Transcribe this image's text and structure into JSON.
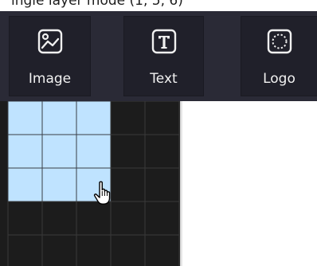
{
  "top_strip": {
    "text": "ingle layer mode (1, 5, 6)"
  },
  "toolbar": {
    "buttons": [
      {
        "label": "Image",
        "icon": "image-icon"
      },
      {
        "label": "Text",
        "icon": "text-icon"
      },
      {
        "label": "Logo",
        "icon": "logo-icon"
      }
    ]
  },
  "grid_selector": {
    "columns": 5,
    "rows": 5,
    "selected_columns": 3,
    "selected_rows": 3,
    "colors": {
      "selected_fill": "#bfe3ff",
      "selected_line": "#3a3f45",
      "empty_fill": "#1c1c1c",
      "empty_line": "#3a3a3a"
    }
  },
  "cursor": {
    "icon": "hand-pointer-icon"
  },
  "colors": {
    "toolbar_bg": "#2a2a36",
    "button_bg": "#20202a",
    "label": "#f2f2f2"
  }
}
